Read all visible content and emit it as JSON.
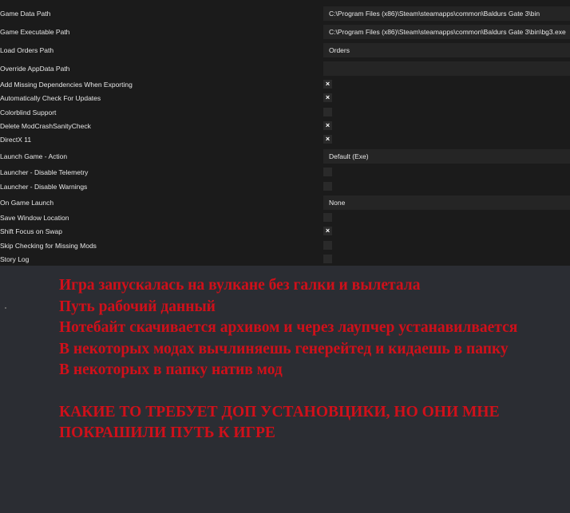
{
  "settings": {
    "game_data_path": {
      "label": "Game Data Path",
      "value": "C:\\Program Files (x86)\\Steam\\steamapps\\common\\Baldurs Gate 3\\bin"
    },
    "game_executable_path": {
      "label": "Game Executable Path",
      "value": "C:\\Program Files (x86)\\Steam\\steamapps\\common\\Baldurs Gate 3\\bin\\bg3.exe"
    },
    "load_orders_path": {
      "label": "Load Orders Path",
      "value": "Orders"
    },
    "override_appdata_path": {
      "label": "Override AppData Path",
      "value": ""
    },
    "add_missing_dependencies": {
      "label": "Add Missing Dependencies When Exporting",
      "checked": true,
      "mark": "×"
    },
    "auto_check_updates": {
      "label": "Automatically Check For Updates",
      "checked": true,
      "mark": "×"
    },
    "colorblind_support": {
      "label": "Colorblind Support",
      "checked": false,
      "mark": ""
    },
    "delete_modcrash_check": {
      "label": "Delete ModCrashSanityCheck",
      "checked": true,
      "mark": "×"
    },
    "directx11": {
      "label": "DirectX 11",
      "checked": true,
      "mark": "×"
    },
    "launch_game_action": {
      "label": "Launch Game - Action",
      "value": "Default (Exe)"
    },
    "launcher_disable_telemetry": {
      "label": "Launcher - Disable Telemetry",
      "checked": false,
      "mark": ""
    },
    "launcher_disable_warnings": {
      "label": "Launcher - Disable Warnings",
      "checked": false,
      "mark": ""
    },
    "on_game_launch": {
      "label": "On Game Launch",
      "value": "None"
    },
    "save_window_location": {
      "label": "Save Window Location",
      "checked": false,
      "mark": ""
    },
    "shift_focus_on_swap": {
      "label": "Shift Focus on Swap",
      "checked": true,
      "mark": "×"
    },
    "skip_checking_missing_mods": {
      "label": "Skip Checking for Missing Mods",
      "checked": false,
      "mark": ""
    },
    "story_log": {
      "label": "Story Log",
      "checked": false,
      "mark": ""
    }
  },
  "notes": {
    "line1": "Игра запускалась на вулкане без галки и вылетала",
    "line2": "Путь рабочий данный",
    "line3": "Нотебайт скачивается архивом и через лаупчер устанавилвается",
    "line4": "В некоторых модах вычлиняешь генерейтед и кидаешь в папку",
    "line5": "В некоторых в папку натив мод",
    "line6": "КАКИЕ ТО ТРЕБУЕТ ДОП УСТАНОВЦИКИ, НО ОНИ МНЕ ПОКРАШИЛИ ПУТЬ К ИГРЕ"
  },
  "colors": {
    "settings_bg": "#1b1b1b",
    "note_text": "#d0101a",
    "page_bg": "#2b2d33"
  }
}
